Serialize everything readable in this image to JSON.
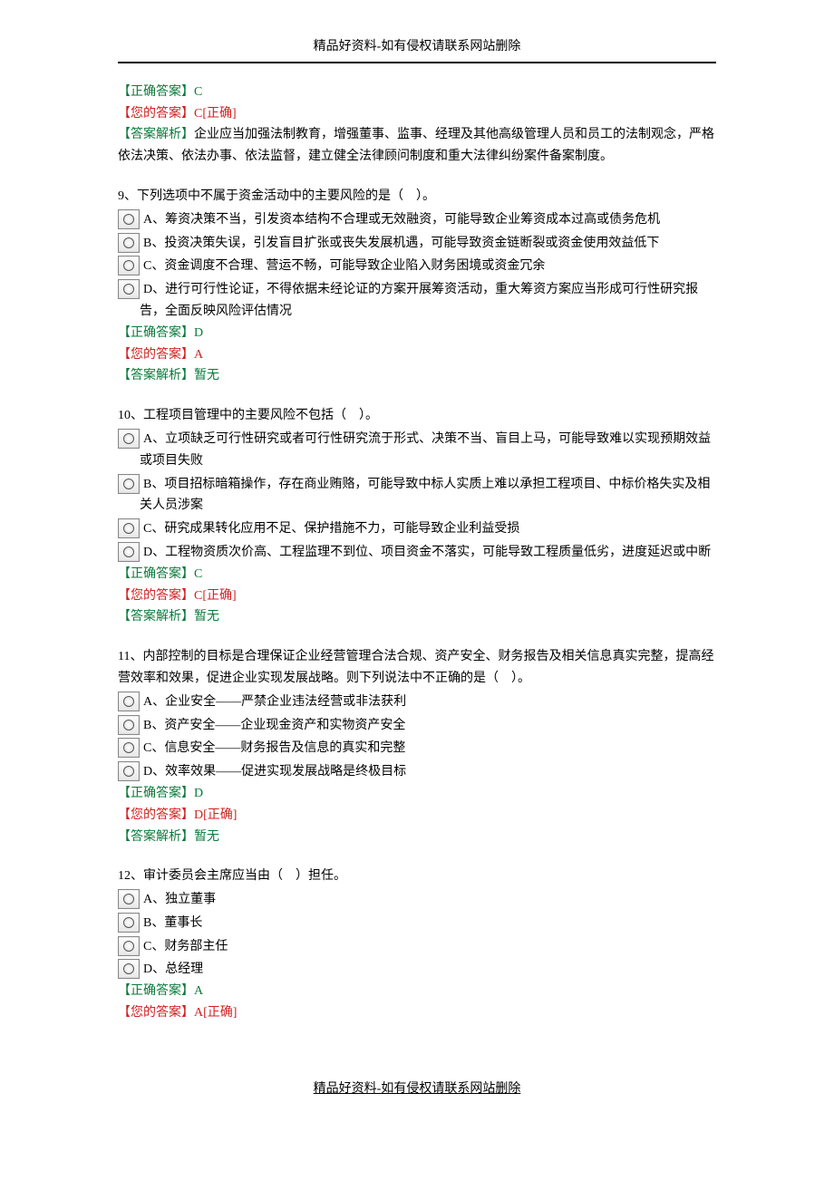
{
  "header": "精品好资料-如有侵权请联系网站删除",
  "footer": "精品好资料-如有侵权请联系网站删除",
  "block8": {
    "correct_label": "【正确答案】",
    "correct_val": "C",
    "your_label": "【您的答案】",
    "your_val": "C",
    "your_mark": "[正确]",
    "explain_label": "【答案解析】",
    "explain_text": "企业应当加强法制教育，增强董事、监事、经理及其他高级管理人员和员工的法制观念，严格依法决策、依法办事、依法监督，建立健全法律顾问制度和重大法律纠纷案件备案制度。"
  },
  "q9": {
    "stem": "9、下列选项中不属于资金活动中的主要风险的是（　）。",
    "A": "A、筹资决策不当，引发资本结构不合理或无效融资，可能导致企业筹资成本过高或债务危机",
    "B": "B、投资决策失误，引发盲目扩张或丧失发展机遇，可能导致资金链断裂或资金使用效益低下",
    "C": "C、资金调度不合理、营运不畅，可能导致企业陷入财务困境或资金冗余",
    "D": "D、进行可行性论证，不得依据未经论证的方案开展筹资活动，重大筹资方案应当形成可行性研究报告，全面反映风险评估情况",
    "correct_label": "【正确答案】",
    "correct_val": "D",
    "your_label": "【您的答案】",
    "your_val": "A",
    "explain_label": "【答案解析】",
    "explain_text": "暂无"
  },
  "q10": {
    "stem": "10、工程项目管理中的主要风险不包括（　）。",
    "A": "A、立项缺乏可行性研究或者可行性研究流于形式、决策不当、盲目上马，可能导致难以实现预期效益或项目失败",
    "B": "B、项目招标暗箱操作，存在商业贿赂，可能导致中标人实质上难以承担工程项目、中标价格失实及相关人员涉案",
    "C": "C、研究成果转化应用不足、保护措施不力，可能导致企业利益受损",
    "D": "D、工程物资质次价高、工程监理不到位、项目资金不落实，可能导致工程质量低劣，进度延迟或中断",
    "correct_label": "【正确答案】",
    "correct_val": "C",
    "your_label": "【您的答案】",
    "your_val": "C",
    "your_mark": "[正确]",
    "explain_label": "【答案解析】",
    "explain_text": "暂无"
  },
  "q11": {
    "stem": "11、内部控制的目标是合理保证企业经营管理合法合规、资产安全、财务报告及相关信息真实完整，提高经营效率和效果，促进企业实现发展战略。则下列说法中不正确的是（　）。",
    "A": "A、企业安全——严禁企业违法经营或非法获利",
    "B": "B、资产安全——企业现金资产和实物资产安全",
    "C": "C、信息安全——财务报告及信息的真实和完整",
    "D": "D、效率效果——促进实现发展战略是终极目标",
    "correct_label": "【正确答案】",
    "correct_val": "D",
    "your_label": "【您的答案】",
    "your_val": "D",
    "your_mark": "[正确]",
    "explain_label": "【答案解析】",
    "explain_text": "暂无"
  },
  "q12": {
    "stem": "12、审计委员会主席应当由（　）担任。",
    "A": "A、独立董事",
    "B": "B、董事长",
    "C": "C、财务部主任",
    "D": "D、总经理",
    "correct_label": "【正确答案】",
    "correct_val": "A",
    "your_label": "【您的答案】",
    "your_val": "A",
    "your_mark": "[正确]"
  }
}
